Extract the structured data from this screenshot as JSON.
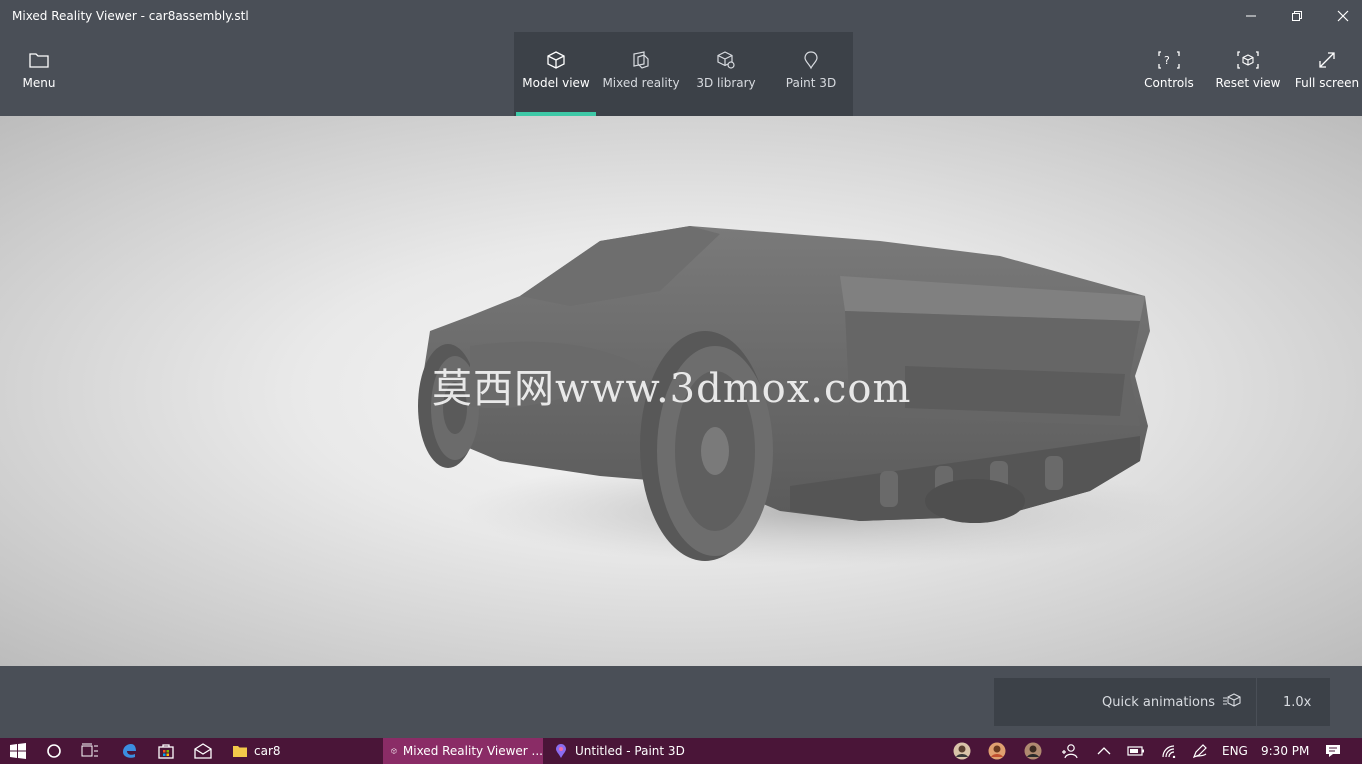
{
  "window": {
    "title": "Mixed Reality Viewer - car8assembly.stl"
  },
  "toolbar": {
    "menu_label": "Menu",
    "tabs": [
      {
        "label": "Model view",
        "active": true
      },
      {
        "label": "Mixed reality",
        "active": false
      },
      {
        "label": "3D library",
        "active": false
      },
      {
        "label": "Paint 3D",
        "active": false
      }
    ],
    "right": [
      {
        "label": "Controls"
      },
      {
        "label": "Reset view"
      },
      {
        "label": "Full screen"
      }
    ],
    "accent_color": "#3ec9a7"
  },
  "viewport": {
    "watermark": "莫西网www.3dmox.com"
  },
  "bottombar": {
    "quick_animations_label": "Quick animations",
    "speed": "1.0x"
  },
  "taskbar": {
    "folder_label": "car8",
    "apps": [
      {
        "label": "Mixed Reality Viewer ...",
        "active": true
      },
      {
        "label": "Untitled - Paint 3D",
        "active": false
      }
    ],
    "language": "ENG",
    "time": "9:30 PM"
  }
}
